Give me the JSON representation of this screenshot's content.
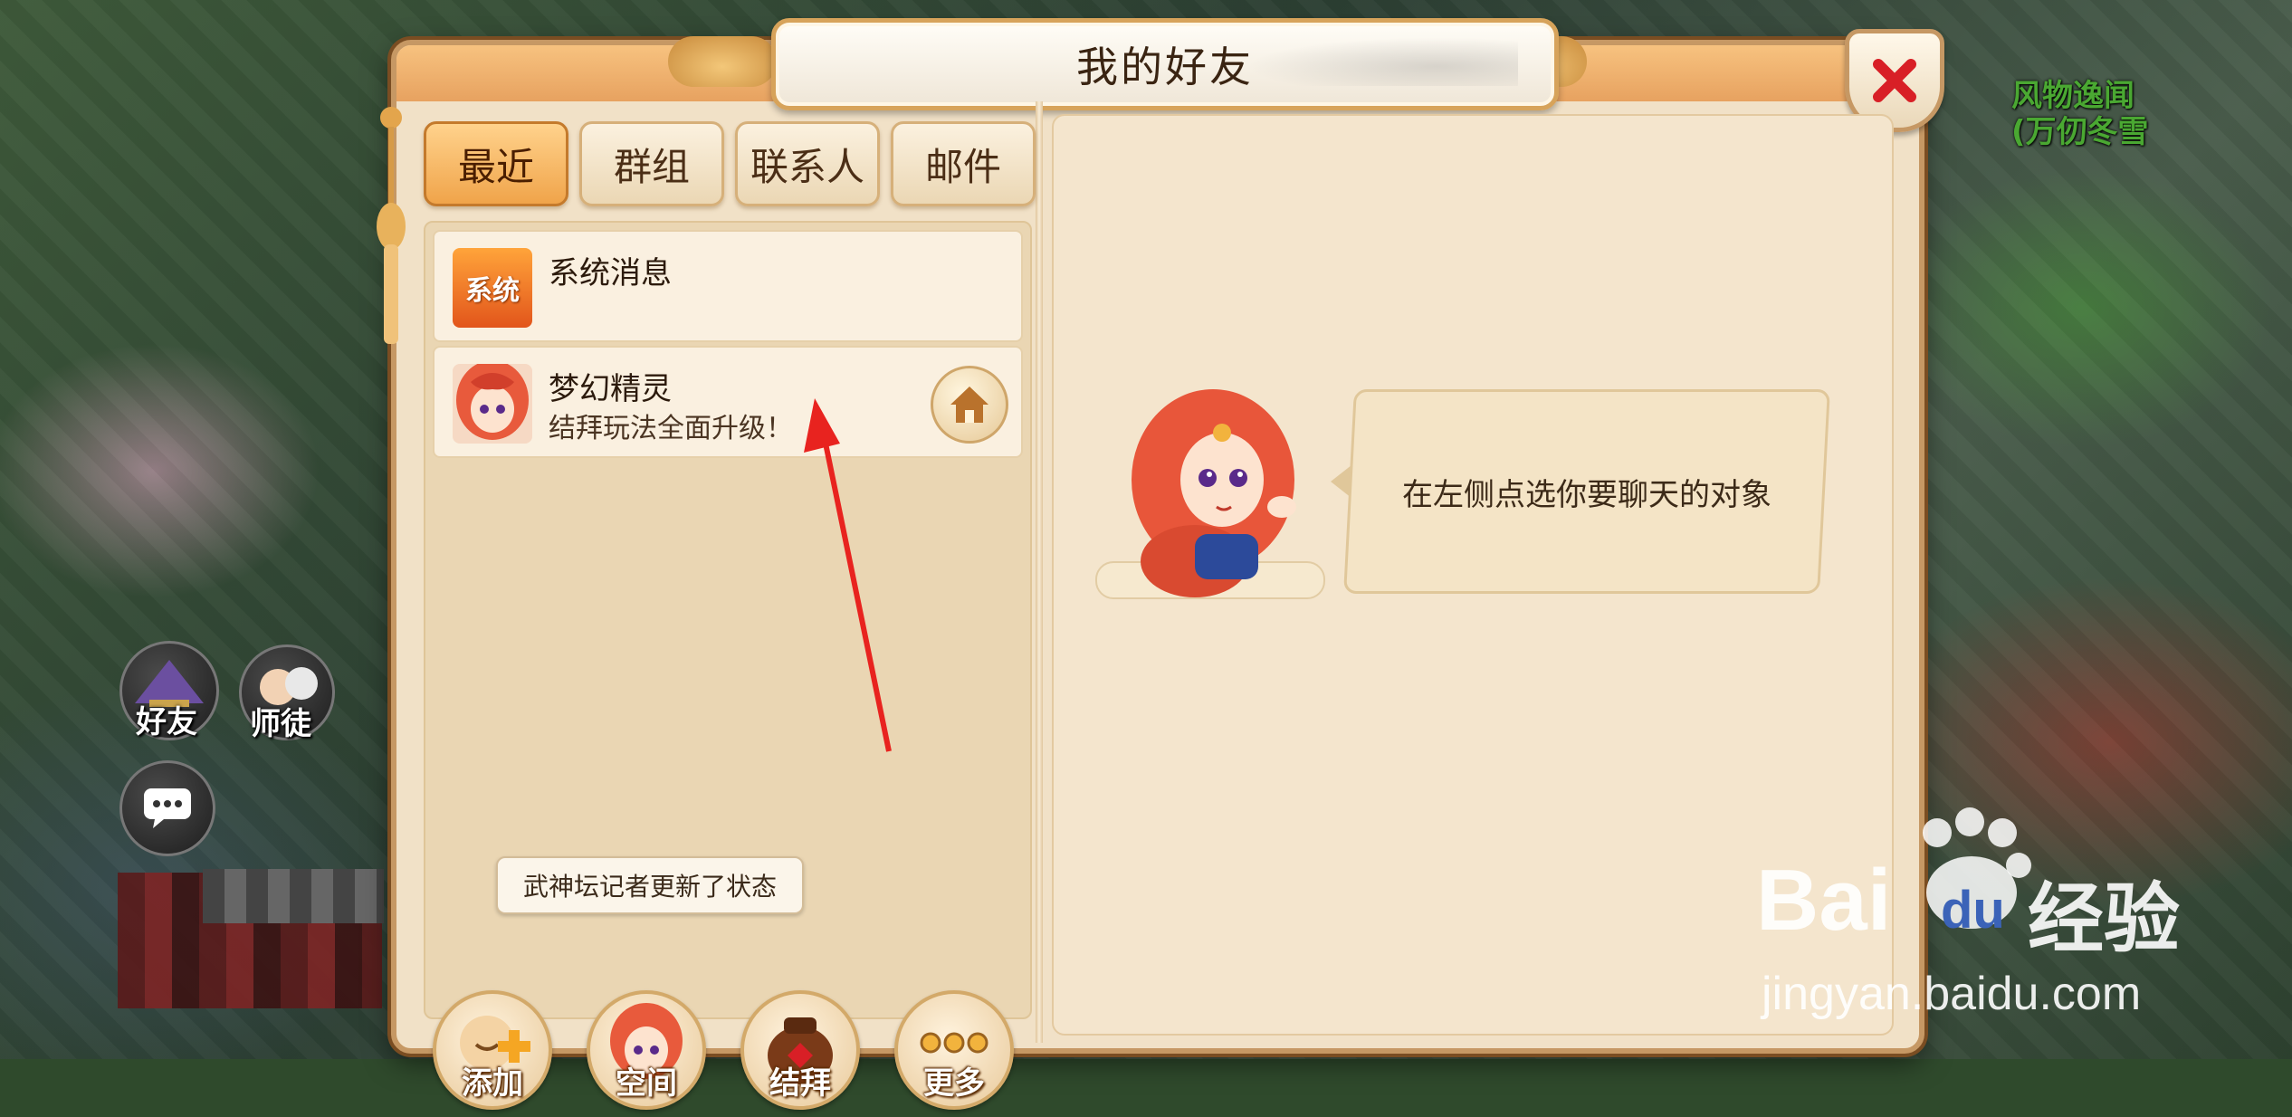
{
  "window": {
    "title": "我的好友"
  },
  "tabs": [
    {
      "label": "最近",
      "active": true
    },
    {
      "label": "群组",
      "active": false
    },
    {
      "label": "联系人",
      "active": false
    },
    {
      "label": "邮件",
      "active": false
    }
  ],
  "conversations": [
    {
      "avatar_text": "系统",
      "title": "系统消息",
      "subtitle": ""
    },
    {
      "avatar_text": "",
      "title": "梦幻精灵",
      "subtitle": "结拜玩法全面升级！"
    }
  ],
  "chat": {
    "prompt": "在左侧点选你要聊天的对象"
  },
  "tooltip": "武神坛记者更新了状态",
  "actions": [
    {
      "label": "添加",
      "icon": "add-friend-icon"
    },
    {
      "label": "空间",
      "icon": "space-icon"
    },
    {
      "label": "结拜",
      "icon": "sworn-brother-icon"
    },
    {
      "label": "更多",
      "icon": "more-icon"
    }
  ],
  "hud": {
    "friends_label": "好友",
    "mentor_label": "师徒",
    "npc_name_line1": "风物逸闻",
    "npc_name_line2": "(万仞冬雪"
  },
  "watermark": {
    "brand_left": "Bai",
    "brand_du": "du",
    "brand_right": "经验",
    "url": "jingyan.baidu.com"
  },
  "colors": {
    "panel_bg": "#f1e1c7",
    "panel_border": "#c69864",
    "tab_active": "#f0a44a",
    "close_red": "#d81f26",
    "arrow_red": "#e8231f"
  }
}
